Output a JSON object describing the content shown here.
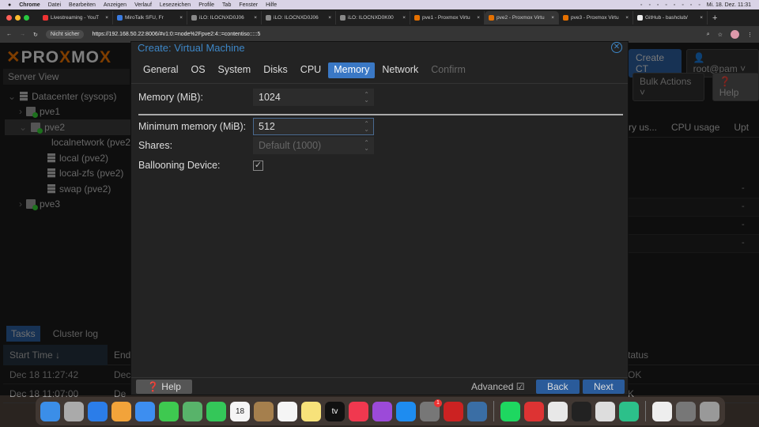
{
  "menubar": {
    "apple": "",
    "app": "Chrome",
    "items": [
      "Datei",
      "Bearbeiten",
      "Anzeigen",
      "Verlauf",
      "Lesezeichen",
      "Profile",
      "Tab",
      "Fenster",
      "Hilfe"
    ],
    "clock": "Mi. 18. Dez. 11:31"
  },
  "browser": {
    "tabs": [
      {
        "title": "Livestreaming - YouT",
        "icon_color": "#e33"
      },
      {
        "title": "MiroTalk SFU, Fr",
        "icon_color": "#3a7be0"
      },
      {
        "title": "iLO: ILOCNXD0J06",
        "icon_color": "#888"
      },
      {
        "title": "iLO: ILOCNXD0J06",
        "icon_color": "#888"
      },
      {
        "title": "iLO: ILOCNXD0K00",
        "icon_color": "#888"
      },
      {
        "title": "pve1 - Proxmox Virtu",
        "icon_color": "#e57000"
      },
      {
        "title": "pve2 - Proxmox Virtu",
        "icon_color": "#e57000",
        "active": true
      },
      {
        "title": "pve3 - Proxmox Virtu",
        "icon_color": "#e57000"
      },
      {
        "title": "GitHub - bashclub/",
        "icon_color": "#eee"
      }
    ],
    "new_tab": "+",
    "insecure_label": "Nicht sicher",
    "url": "https://192.168.50.22:8006/#v1:0:=node%2Fpve2:4::=contentiso:::::5"
  },
  "proxmox": {
    "logo_a": "PRO",
    "logo_b": "MO",
    "logo_c": "X",
    "server_view": "Server View",
    "tree": [
      {
        "label": "Datacenter (sysops)",
        "type": "datacenter",
        "depth": 0
      },
      {
        "label": "pve1",
        "type": "server",
        "depth": 1
      },
      {
        "label": "pve2",
        "type": "server",
        "depth": 1,
        "selected": true
      },
      {
        "label": "localnetwork (pve2)",
        "type": "network",
        "depth": 2
      },
      {
        "label": "local (pve2)",
        "type": "storage",
        "depth": 2
      },
      {
        "label": "local-zfs (pve2)",
        "type": "storage",
        "depth": 2
      },
      {
        "label": "swap (pve2)",
        "type": "storage",
        "depth": 2
      },
      {
        "label": "pve3",
        "type": "server",
        "depth": 1
      }
    ],
    "create_ct": "Create CT",
    "user": "root@pam",
    "bulk_actions": "Bulk Actions",
    "help": "Help",
    "grid_columns": [
      "ry us...",
      "CPU usage",
      "Upt"
    ],
    "grid_rows": [
      "-",
      "-",
      "-",
      "-"
    ],
    "bottom_tabs": [
      "Tasks",
      "Cluster log"
    ],
    "task_columns": [
      "Start Time ↓",
      "End",
      "Status"
    ],
    "task_rows": [
      {
        "start": "Dec 18 11:27:42",
        "end": "Dec",
        "status": "OK"
      },
      {
        "start": "Dec 18 11:07:00",
        "end": "De",
        "status": "K"
      }
    ]
  },
  "dialog": {
    "title": "Create: Virtual Machine",
    "tabs": [
      {
        "label": "General"
      },
      {
        "label": "OS"
      },
      {
        "label": "System"
      },
      {
        "label": "Disks"
      },
      {
        "label": "CPU"
      },
      {
        "label": "Memory",
        "active": true
      },
      {
        "label": "Network"
      },
      {
        "label": "Confirm",
        "disabled": true
      }
    ],
    "memory_label": "Memory (MiB):",
    "memory_value": "1024",
    "min_memory_label": "Minimum memory (MiB):",
    "min_memory_value": "512",
    "shares_label": "Shares:",
    "shares_placeholder": "Default (1000)",
    "ballooning_label": "Ballooning Device:",
    "ballooning_checked": true,
    "help": "Help",
    "advanced": "Advanced",
    "back": "Back",
    "next": "Next"
  },
  "dock": [
    {
      "name": "finder",
      "color": "#3b8ee8"
    },
    {
      "name": "launchpad",
      "color": "#aaa"
    },
    {
      "name": "safari",
      "color": "#2b7de9"
    },
    {
      "name": "photos",
      "color": "#f2a33a"
    },
    {
      "name": "mail",
      "color": "#3d8ef0"
    },
    {
      "name": "messages",
      "color": "#3ec950"
    },
    {
      "name": "maps",
      "color": "#58b36a"
    },
    {
      "name": "facetime",
      "color": "#34c759"
    },
    {
      "name": "calendar",
      "color": "#f5f5f5",
      "text": "18"
    },
    {
      "name": "contacts",
      "color": "#a57f4d"
    },
    {
      "name": "reminders",
      "color": "#f5f5f5"
    },
    {
      "name": "notes",
      "color": "#f7e27a"
    },
    {
      "name": "apple-tv",
      "color": "#111",
      "text": "tv"
    },
    {
      "name": "music",
      "color": "#f0384f"
    },
    {
      "name": "podcasts",
      "color": "#9c4ad9"
    },
    {
      "name": "app-store",
      "color": "#1e8cf0"
    },
    {
      "name": "system-settings",
      "color": "#777",
      "badge": "1"
    },
    {
      "name": "cisco-webex",
      "color": "#c22"
    },
    {
      "name": "quicktime",
      "color": "#3a6ea5"
    },
    {
      "sep": true
    },
    {
      "name": "spotify",
      "color": "#1ed760"
    },
    {
      "name": "vpn-app",
      "color": "#d33"
    },
    {
      "name": "chrome",
      "color": "#e8e8e8"
    },
    {
      "name": "terminal",
      "color": "#222"
    },
    {
      "name": "calculator",
      "color": "#ddd"
    },
    {
      "name": "sync-app",
      "color": "#2cc08a"
    },
    {
      "sep": true
    },
    {
      "name": "document",
      "color": "#eee"
    },
    {
      "name": "downloads",
      "color": "#777"
    },
    {
      "name": "trash",
      "color": "#999"
    }
  ]
}
